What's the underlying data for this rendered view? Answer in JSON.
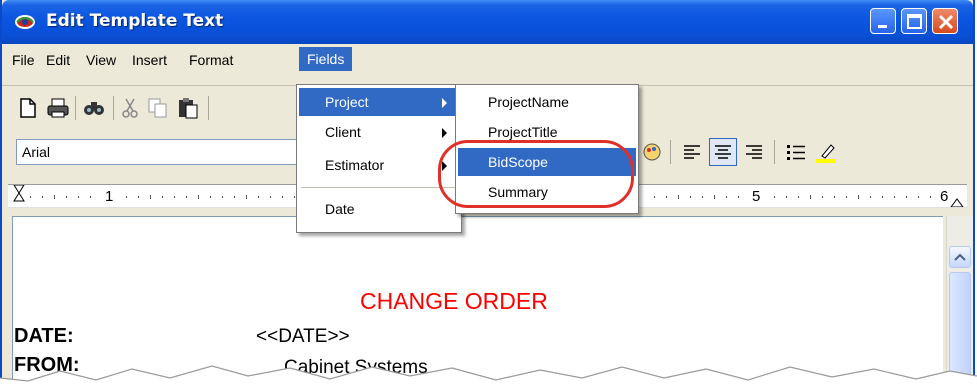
{
  "window": {
    "title": "Edit Template Text"
  },
  "menubar": {
    "items": [
      "File",
      "Edit",
      "View",
      "Insert",
      "Format",
      "Fields"
    ]
  },
  "toolbar": {
    "font_name": "Arial"
  },
  "ruler": {
    "marks": [
      "1",
      "5",
      "6"
    ]
  },
  "fields_menu": {
    "items": [
      {
        "label": "Project",
        "submenu": true
      },
      {
        "label": "Client",
        "submenu": true
      },
      {
        "label": "Estimator",
        "submenu": true
      },
      {
        "label": "Date",
        "submenu": false
      }
    ]
  },
  "project_submenu": {
    "items": [
      "ProjectName",
      "ProjectTitle",
      "BidScope",
      "Summary"
    ]
  },
  "document": {
    "title": "CHANGE ORDER",
    "rows": [
      {
        "label": "DATE:",
        "value": "<<DATE>>"
      },
      {
        "label": "FROM:",
        "value": "Cabinet Systems"
      }
    ]
  },
  "colors": {
    "title_bar": "#0a4fd6",
    "menu_highlight": "#316ac5",
    "doc_title": "#ff0000",
    "annotation_circle": "#e0302a"
  },
  "icons": [
    "app-icon",
    "minimize-icon",
    "maximize-icon",
    "close-icon",
    "new-document-icon",
    "print-icon",
    "find-icon",
    "cut-icon",
    "copy-icon",
    "paste-icon",
    "align-left-icon",
    "align-center-icon",
    "align-right-icon",
    "bullets-icon",
    "highlight-icon"
  ]
}
